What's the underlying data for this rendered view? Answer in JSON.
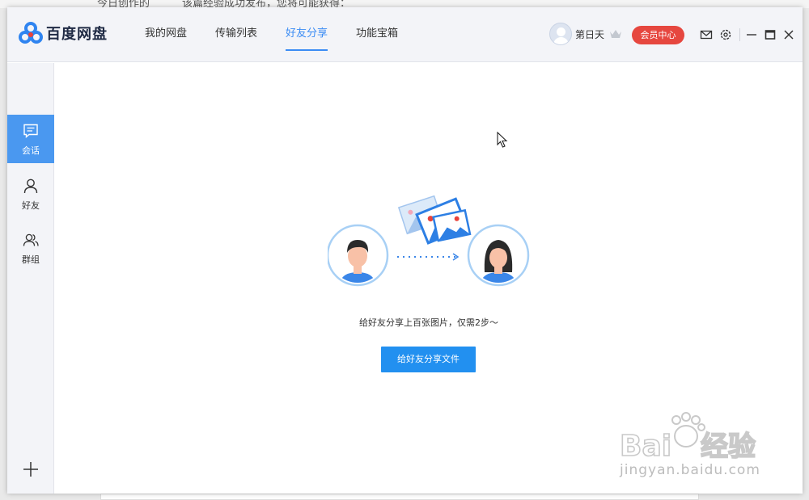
{
  "background": {
    "text_left": "今日创作的",
    "text_right": "该篇经验成功发布，您将可能获得："
  },
  "app": {
    "name": "百度网盘",
    "brand_color": "#3b8cf4"
  },
  "nav": {
    "tabs": [
      {
        "label": "我的网盘",
        "active": false
      },
      {
        "label": "传输列表",
        "active": false
      },
      {
        "label": "好友分享",
        "active": true
      },
      {
        "label": "功能宝箱",
        "active": false
      }
    ]
  },
  "user": {
    "name": "第日天",
    "vip_button": "会员中心",
    "vip_color": "#e6473f"
  },
  "toolbar": {
    "icons": [
      "mail-icon",
      "settings-icon",
      "minimize-icon",
      "maximize-icon",
      "close-icon"
    ]
  },
  "sidebar": {
    "items": [
      {
        "label": "会话",
        "icon": "chat-icon",
        "active": true
      },
      {
        "label": "好友",
        "icon": "person-icon",
        "active": false
      },
      {
        "label": "群组",
        "icon": "group-icon",
        "active": false
      }
    ],
    "add_icon": "plus-icon"
  },
  "main": {
    "caption": "给好友分享上百张图片，仅需2步～",
    "share_button": "给好友分享文件",
    "button_color": "#2290f0"
  },
  "watermark": {
    "site": "jingyan.baidu.com"
  }
}
